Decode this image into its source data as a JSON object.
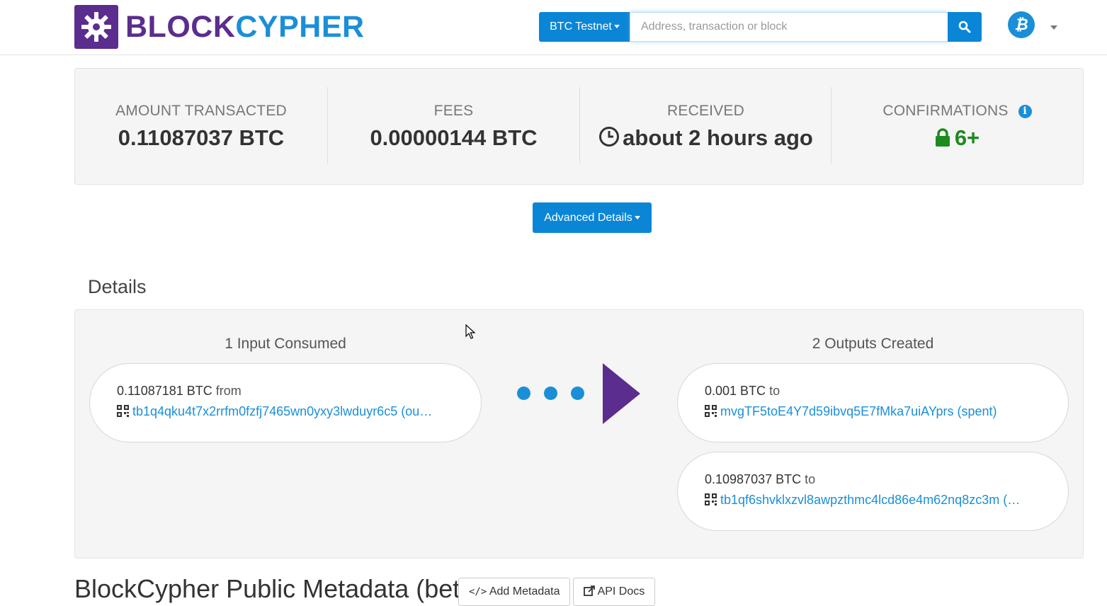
{
  "brand": {
    "part1": "BLOCK",
    "part2": "CYPHER",
    "logo_icon": "gear-logo-icon"
  },
  "colors": {
    "brand_purple": "#5b2d8e",
    "accent_blue": "#0b86d6",
    "link_blue": "#1a8fd8",
    "confirm_green": "#1f8a1f"
  },
  "header": {
    "network_label": "BTC Testnet",
    "search_placeholder": "Address, transaction or block",
    "search_value": "",
    "coin_symbol": "₿"
  },
  "summary": {
    "amount_label": "AMOUNT TRANSACTED",
    "amount_value": "0.11087037 BTC",
    "fees_label": "FEES",
    "fees_value": "0.00000144 BTC",
    "received_label": "RECEIVED",
    "received_value": "about 2 hours ago",
    "confirmations_label": "CONFIRMATIONS",
    "confirmations_value": "6+"
  },
  "advanced_details_label": "Advanced Details",
  "details": {
    "title": "Details",
    "inputs_title": "1 Input Consumed",
    "outputs_title": "2 Outputs Created",
    "inputs": [
      {
        "amount": "0.11087181 BTC",
        "suffix": "from",
        "address": "tb1q4qku4t7x2rrfm0fzfj7465wn0yxy3lwduyr6c5",
        "note": "(ou…"
      }
    ],
    "outputs": [
      {
        "amount": "0.001 BTC",
        "suffix": "to",
        "address": "mvgTF5toE4Y7d59ibvq5E7fMka7uiAYprs",
        "note": "(spent)"
      },
      {
        "amount": "0.10987037 BTC",
        "suffix": "to",
        "address": "tb1qf6shvklxzvl8awpzthmc4lcd86e4m62nq8zc3m",
        "note": "(…"
      }
    ]
  },
  "metadata": {
    "title": "BlockCypher Public Metadata (beta)",
    "add_label": "Add Metadata",
    "docs_label": "API Docs"
  }
}
